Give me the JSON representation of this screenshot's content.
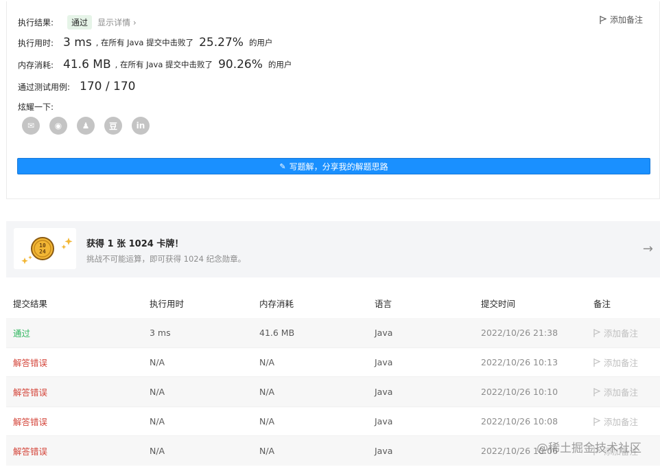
{
  "result": {
    "status_label": "执行结果:",
    "status_value": "通过",
    "details_link": "显示详情 ›",
    "add_note": "添加备注",
    "runtime_label": "执行用时:",
    "runtime_value": "3 ms",
    "runtime_text": ", 在所有 Java 提交中击败了",
    "runtime_pct": "25.27%",
    "runtime_suffix": "的用户",
    "memory_label": "内存消耗:",
    "memory_value": "41.6 MB",
    "memory_text": ", 在所有 Java 提交中击败了",
    "memory_pct": "90.26%",
    "memory_suffix": "的用户",
    "tests_label": "通过测试用例:",
    "tests_value": "170 / 170",
    "share_label": "炫耀一下:",
    "share_icons": [
      "wechat-icon",
      "weibo-icon",
      "qq-icon",
      "douban-icon",
      "linkedin-icon"
    ],
    "share_glyphs": [
      "✉",
      "◉",
      "♟",
      "豆",
      "in"
    ],
    "write_button": "写题解，分享我的解题思路"
  },
  "banner": {
    "title": "获得 1 张 1024 卡牌！",
    "subtitle": "挑战不可能运算，即可获得 1024 纪念勋章。",
    "coin_text_top": "10",
    "coin_text_bottom": "24"
  },
  "table": {
    "headers": [
      "提交结果",
      "执行用时",
      "内存消耗",
      "语言",
      "提交时间",
      "备注"
    ],
    "rows": [
      {
        "result": "通过",
        "status": "ok",
        "time": "3 ms",
        "memory": "41.6 MB",
        "lang": "Java",
        "submitted": "2022/10/26 21:38",
        "note": "添加备注"
      },
      {
        "result": "解答错误",
        "status": "err",
        "time": "N/A",
        "memory": "N/A",
        "lang": "Java",
        "submitted": "2022/10/26 10:13",
        "note": "添加备注"
      },
      {
        "result": "解答错误",
        "status": "err",
        "time": "N/A",
        "memory": "N/A",
        "lang": "Java",
        "submitted": "2022/10/26 10:10",
        "note": "添加备注"
      },
      {
        "result": "解答错误",
        "status": "err",
        "time": "N/A",
        "memory": "N/A",
        "lang": "Java",
        "submitted": "2022/10/26 10:08",
        "note": "添加备注"
      },
      {
        "result": "解答错误",
        "status": "err",
        "time": "N/A",
        "memory": "N/A",
        "lang": "Java",
        "submitted": "2022/10/26 10:06",
        "note": "添加备注"
      }
    ]
  },
  "watermark": "@稀土掘金技术社区",
  "colors": {
    "accent": "#1a90ff",
    "success": "#2db55d",
    "error": "#d4463b"
  }
}
